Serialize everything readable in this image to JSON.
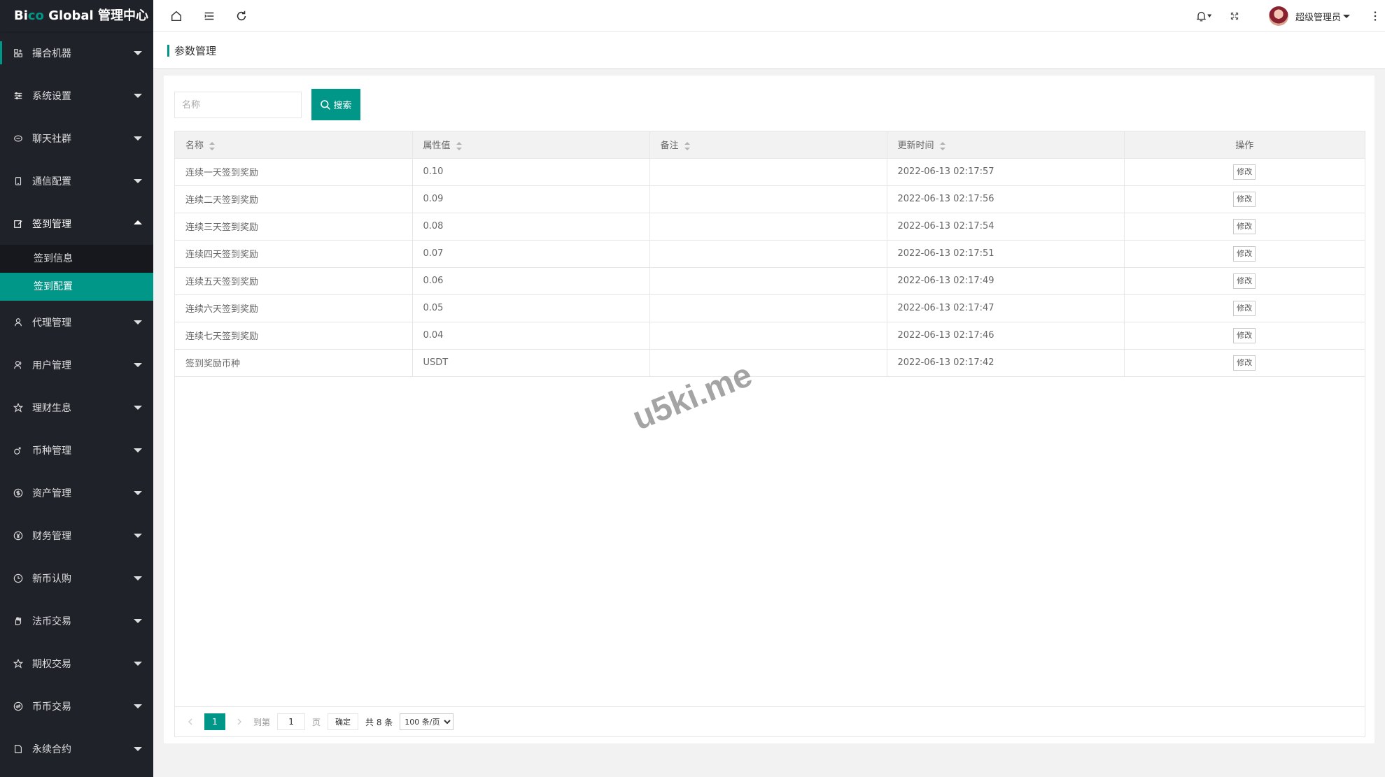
{
  "app": {
    "logo_prefix": "Bi",
    "logo_accent": "co",
    "logo_suffix": " Global 管理中心"
  },
  "sidebar": {
    "items": [
      {
        "label": "撮合机器",
        "icon": "robot-icon"
      },
      {
        "label": "系统设置",
        "icon": "sliders-icon"
      },
      {
        "label": "聊天社群",
        "icon": "chat-icon"
      },
      {
        "label": "通信配置",
        "icon": "phone-icon"
      },
      {
        "label": "签到管理",
        "icon": "edit-icon",
        "open": true
      }
    ],
    "sub_items": [
      {
        "label": "签到信息"
      },
      {
        "label": "签到配置",
        "active": true
      }
    ],
    "items_after": [
      {
        "label": "代理管理",
        "icon": "user-icon"
      },
      {
        "label": "用户管理",
        "icon": "users-icon"
      },
      {
        "label": "理财生息",
        "icon": "star-icon"
      },
      {
        "label": "币种管理",
        "icon": "coins-icon"
      },
      {
        "label": "资产管理",
        "icon": "dollar-icon"
      },
      {
        "label": "财务管理",
        "icon": "yen-icon"
      },
      {
        "label": "新币认购",
        "icon": "clock-icon"
      },
      {
        "label": "法币交易",
        "icon": "hand-icon"
      },
      {
        "label": "期权交易",
        "icon": "star-icon"
      },
      {
        "label": "币币交易",
        "icon": "exchange-icon"
      },
      {
        "label": "永续合约",
        "icon": "file-icon"
      }
    ]
  },
  "header": {
    "user_name": "超级管理员"
  },
  "page": {
    "title": "参数管理"
  },
  "search": {
    "placeholder": "名称",
    "button_label": "搜索"
  },
  "table": {
    "columns": [
      "名称",
      "属性值",
      "备注",
      "更新时间",
      "操作"
    ],
    "action_label": "修改",
    "rows": [
      {
        "name": "连续一天签到奖励",
        "value": "0.10",
        "remark": "",
        "updated": "2022-06-13 02:17:57"
      },
      {
        "name": "连续二天签到奖励",
        "value": "0.09",
        "remark": "",
        "updated": "2022-06-13 02:17:56"
      },
      {
        "name": "连续三天签到奖励",
        "value": "0.08",
        "remark": "",
        "updated": "2022-06-13 02:17:54"
      },
      {
        "name": "连续四天签到奖励",
        "value": "0.07",
        "remark": "",
        "updated": "2022-06-13 02:17:51"
      },
      {
        "name": "连续五天签到奖励",
        "value": "0.06",
        "remark": "",
        "updated": "2022-06-13 02:17:49"
      },
      {
        "name": "连续六天签到奖励",
        "value": "0.05",
        "remark": "",
        "updated": "2022-06-13 02:17:47"
      },
      {
        "name": "连续七天签到奖励",
        "value": "0.04",
        "remark": "",
        "updated": "2022-06-13 02:17:46"
      },
      {
        "name": "签到奖励币种",
        "value": "USDT",
        "remark": "",
        "updated": "2022-06-13 02:17:42"
      }
    ]
  },
  "pagination": {
    "current_page": "1",
    "goto_label": "到第",
    "goto_value": "1",
    "page_unit": "页",
    "confirm_label": "确定",
    "total_label": "共 8 条",
    "page_size": "100 条/页"
  },
  "watermark": "u5ki.me",
  "colors": {
    "accent": "#009688",
    "sidebar_bg": "#20222a"
  }
}
